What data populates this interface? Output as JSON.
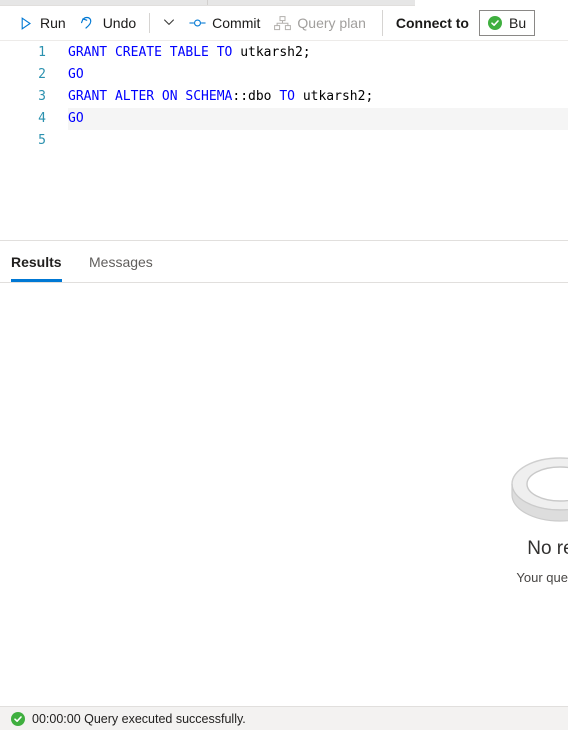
{
  "toolbar": {
    "run_label": "Run",
    "run_icon": "play-triangle-icon",
    "undo_label": "Undo",
    "undo_icon": "undo-arrow-icon",
    "undo_caret_icon": "chevron-down-icon",
    "commit_label": "Commit",
    "commit_icon": "commit-node-icon",
    "query_plan_label": "Query plan",
    "query_plan_icon": "query-plan-hierarchy-icon",
    "query_plan_disabled": true,
    "connect_to_label": "Connect to",
    "connection": {
      "status_icon": "green-check-circle-icon",
      "value": "Bu",
      "status_color": "#3faf3f"
    }
  },
  "editor": {
    "lines": [
      {
        "number": "1",
        "active": false,
        "tokens": [
          {
            "text": "GRANT CREATE TABLE TO ",
            "type": "keyword"
          },
          {
            "text": "utkarsh2;",
            "type": "plain"
          }
        ]
      },
      {
        "number": "2",
        "active": false,
        "tokens": [
          {
            "text": "GO",
            "type": "keyword"
          }
        ]
      },
      {
        "number": "3",
        "active": false,
        "tokens": [
          {
            "text": "GRANT ALTER ON SCHEMA",
            "type": "keyword"
          },
          {
            "text": "::dbo ",
            "type": "plain"
          },
          {
            "text": "TO ",
            "type": "keyword"
          },
          {
            "text": "utkarsh2;",
            "type": "plain"
          }
        ]
      },
      {
        "number": "4",
        "active": true,
        "tokens": [
          {
            "text": "GO",
            "type": "keyword"
          }
        ]
      },
      {
        "number": "5",
        "active": false,
        "tokens": []
      }
    ],
    "keyword_color": "#0000ff",
    "gutter_color": "#2b91af",
    "active_line_color": "#f5f5f5"
  },
  "results_panel": {
    "tabs": [
      {
        "label": "Results",
        "active": true
      },
      {
        "label": "Messages",
        "active": false
      }
    ],
    "accent_color": "#0078d4",
    "empty_state": {
      "illustration": "no-results-illustration",
      "title": "No results",
      "subtitle": "Your query yielded"
    }
  },
  "status_bar": {
    "icon": "green-check-circle-icon",
    "duration": "00:00:00",
    "message": "Query executed successfully.",
    "full_text": "00:00:00 Query executed successfully."
  }
}
